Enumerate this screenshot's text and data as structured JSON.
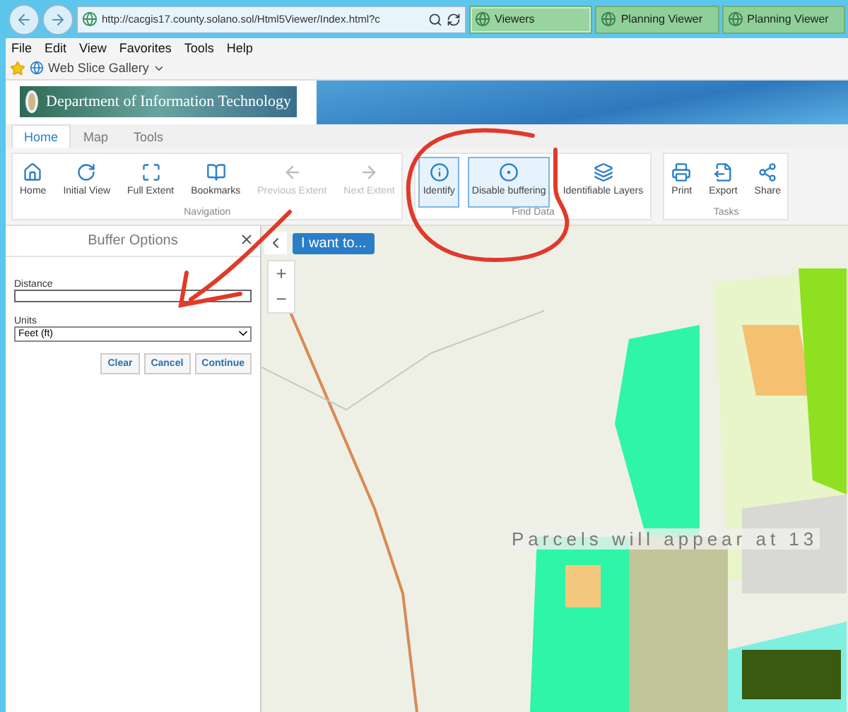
{
  "browser": {
    "address": "http://cacgis17.county.solano.sol/Html5Viewer/Index.html?c",
    "tabs": [
      {
        "label": "Viewers",
        "selected": true
      },
      {
        "label": "Planning Viewer",
        "selected": false
      },
      {
        "label": "Planning Viewer",
        "selected": false
      }
    ],
    "menu": [
      "File",
      "Edit",
      "View",
      "Favorites",
      "Tools",
      "Help"
    ],
    "favorites": {
      "label": "Web Slice Gallery"
    }
  },
  "banner": {
    "title": "Department of Information Technology"
  },
  "ribbon": {
    "tabs": [
      {
        "label": "Home",
        "selected": true
      },
      {
        "label": "Map",
        "selected": false
      },
      {
        "label": "Tools",
        "selected": false
      }
    ],
    "groups": [
      {
        "label": "Navigation",
        "buttons": [
          {
            "kind": "home",
            "label": "Home",
            "disabled": false,
            "selected": false
          },
          {
            "kind": "initial",
            "label": "Initial View",
            "disabled": false,
            "selected": false
          },
          {
            "kind": "full",
            "label": "Full Extent",
            "disabled": false,
            "selected": false
          },
          {
            "kind": "bookmarks",
            "label": "Bookmarks",
            "disabled": false,
            "selected": false
          },
          {
            "kind": "previous",
            "label": "Previous Extent",
            "disabled": true,
            "selected": false
          },
          {
            "kind": "next",
            "label": "Next Extent",
            "disabled": true,
            "selected": false
          }
        ]
      },
      {
        "label": "Find Data",
        "buttons": [
          {
            "kind": "identify",
            "label": "Identify",
            "disabled": false,
            "selected": true
          },
          {
            "kind": "buffer",
            "label": "Disable buffering",
            "disabled": false,
            "selected": true
          },
          {
            "kind": "layers",
            "label": "Identifiable Layers",
            "disabled": false,
            "selected": false
          }
        ]
      },
      {
        "label": "Tasks",
        "buttons": [
          {
            "kind": "print",
            "label": "Print",
            "disabled": false,
            "selected": false
          },
          {
            "kind": "export",
            "label": "Export",
            "disabled": false,
            "selected": false
          },
          {
            "kind": "share",
            "label": "Share",
            "disabled": false,
            "selected": false
          }
        ]
      }
    ]
  },
  "panel": {
    "title": "Buffer Options",
    "distance": {
      "label": "Distance"
    },
    "units": {
      "label": "Units",
      "value": "Feet (ft)"
    },
    "buttons": [
      "Clear",
      "Cancel",
      "Continue"
    ]
  },
  "map": {
    "i_want_to": "I want to...",
    "zoom": [
      "+",
      "−"
    ],
    "notice": "Parcels will appear at 13"
  }
}
